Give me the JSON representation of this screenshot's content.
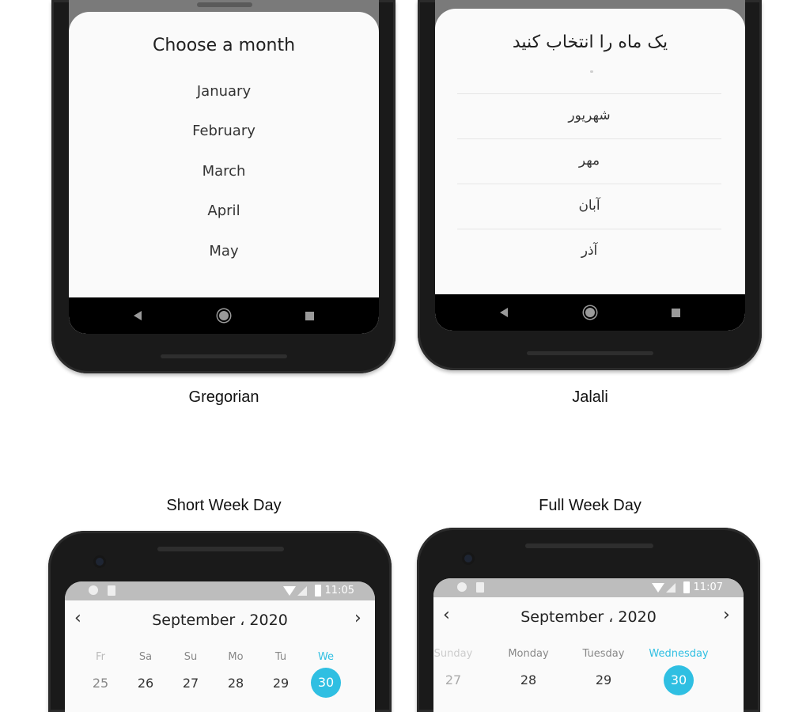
{
  "gregorian": {
    "title": "Choose a month",
    "months": [
      "January",
      "February",
      "March",
      "April",
      "May"
    ],
    "caption": "Gregorian"
  },
  "jalali": {
    "title": "یک ماه را انتخاب کنید",
    "months": [
      "شهریور",
      "مهر",
      "آبان",
      "آذر"
    ],
    "caption": "Jalali"
  },
  "short_week": {
    "caption": "Short Week Day",
    "time": "11:05",
    "header": "September ، 2020",
    "weekdays": [
      "Fr",
      "Sa",
      "Su",
      "Mo",
      "Tu",
      "We"
    ],
    "days": [
      "25",
      "26",
      "27",
      "28",
      "29",
      "30"
    ],
    "selected_day": "30"
  },
  "full_week": {
    "caption": "Full Week Day",
    "time": "11:07",
    "header": "September ، 2020",
    "weekdays": [
      "Sunday",
      "Monday",
      "Tuesday",
      "Wednesday"
    ],
    "days": [
      "27",
      "28",
      "29",
      "30"
    ],
    "selected_day": "30"
  },
  "nav": {
    "back": "back-icon",
    "home": "home-icon",
    "recents": "recents-icon"
  },
  "colors": {
    "accent": "#2fbfe2",
    "bezel": "#1a1a1a",
    "statusbar": "#bdbdbd"
  }
}
